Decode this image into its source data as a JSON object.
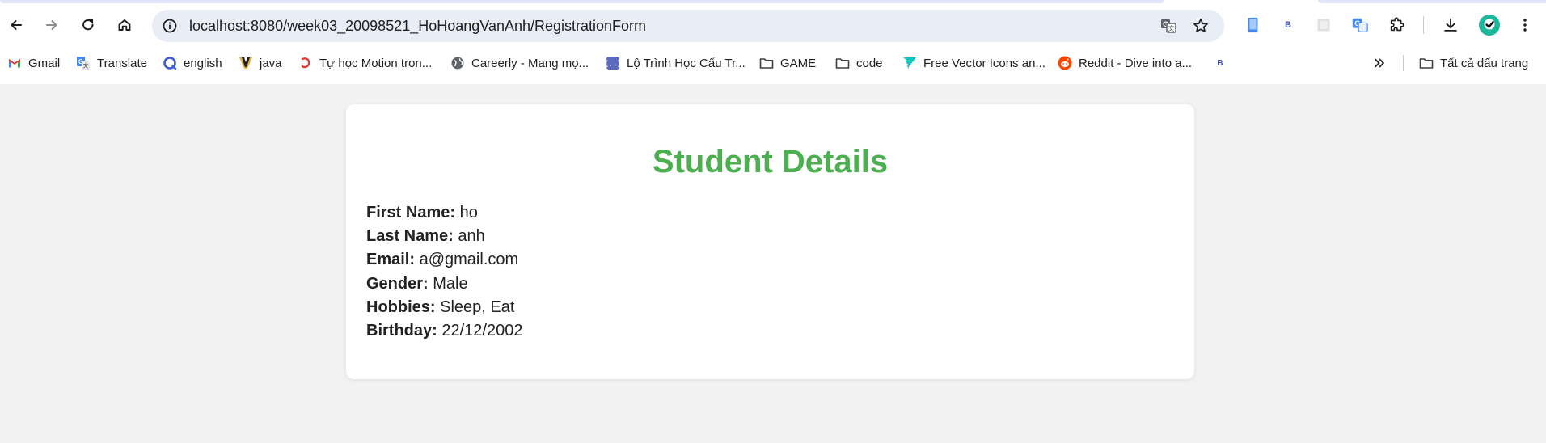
{
  "browser": {
    "url": "localhost:8080/week03_20098521_HoHoangVanAnh/RegistrationForm",
    "bookmarks": [
      {
        "label": "Gmail",
        "icon": "gmail-icon"
      },
      {
        "label": "Translate",
        "icon": "translate-icon"
      },
      {
        "label": "english",
        "icon": "english-icon"
      },
      {
        "label": "java",
        "icon": "java-icon"
      },
      {
        "label": "Tự học Motion tron...",
        "icon": "motion-icon"
      },
      {
        "label": "Careerly - Mang mọ...",
        "icon": "globe-icon"
      },
      {
        "label": "Lộ Trình Học Cấu Tr...",
        "icon": "code-brackets-icon"
      },
      {
        "label": "GAME",
        "icon": "folder-icon"
      },
      {
        "label": "code",
        "icon": "folder-icon"
      },
      {
        "label": "Free Vector Icons an...",
        "icon": "freepik-icon"
      },
      {
        "label": "Reddit - Dive into a...",
        "icon": "reddit-icon"
      },
      {
        "label": "",
        "icon": "b-icon"
      }
    ],
    "all_bookmarks_label": "Tất cả dấu trang",
    "ext_b_label": "B",
    "colors": {
      "toolbar_bg": "#ffffff",
      "omnibox_bg": "#e9edf6",
      "page_bg": "#f2f2f2"
    }
  },
  "page": {
    "title": "Student Details",
    "title_color": "#4caf50",
    "fields": [
      {
        "label": "First Name:",
        "value": "ho"
      },
      {
        "label": "Last Name:",
        "value": "anh"
      },
      {
        "label": "Email:",
        "value": "a@gmail.com"
      },
      {
        "label": "Gender:",
        "value": "Male"
      },
      {
        "label": "Hobbies:",
        "value": "Sleep, Eat"
      },
      {
        "label": "Birthday:",
        "value": "22/12/2002"
      }
    ]
  }
}
